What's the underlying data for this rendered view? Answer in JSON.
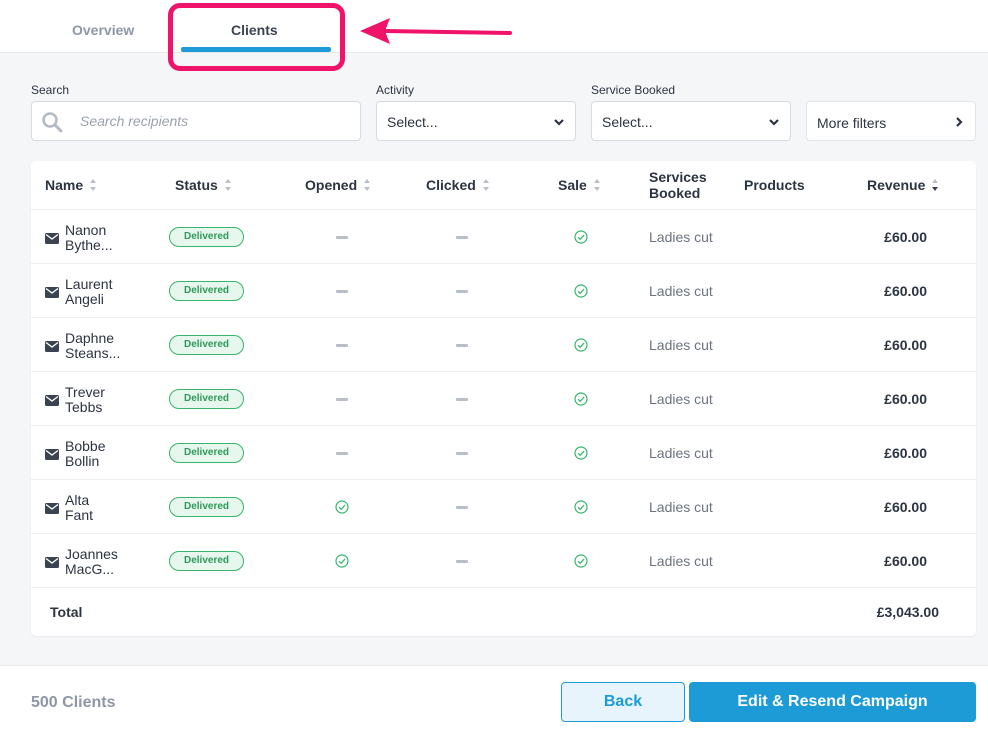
{
  "tabs": [
    {
      "label": "Overview"
    },
    {
      "label": "Clients"
    }
  ],
  "filters": {
    "search_label": "Search",
    "search_placeholder": "Search recipients",
    "activity_label": "Activity",
    "activity_value": "Select...",
    "service_label": "Service Booked",
    "service_value": "Select...",
    "more_filters": "More filters"
  },
  "table": {
    "columns": [
      "Name",
      "Status",
      "Opened",
      "Clicked",
      "Sale",
      "Services Booked",
      "Products",
      "Revenue"
    ],
    "services_booked_line1": "Services",
    "services_booked_line2": "Booked",
    "rows": [
      {
        "name1": "Nanon",
        "name2": "Bythe...",
        "status": "Delivered",
        "opened": false,
        "clicked": false,
        "sale": true,
        "service": "Ladies cut",
        "revenue": "£60.00"
      },
      {
        "name1": "Laurent",
        "name2": "Angeli",
        "status": "Delivered",
        "opened": false,
        "clicked": false,
        "sale": true,
        "service": "Ladies cut",
        "revenue": "£60.00"
      },
      {
        "name1": "Daphne",
        "name2": "Steans...",
        "status": "Delivered",
        "opened": false,
        "clicked": false,
        "sale": true,
        "service": "Ladies cut",
        "revenue": "£60.00"
      },
      {
        "name1": "Trever",
        "name2": "Tebbs",
        "status": "Delivered",
        "opened": false,
        "clicked": false,
        "sale": true,
        "service": "Ladies cut",
        "revenue": "£60.00"
      },
      {
        "name1": "Bobbe",
        "name2": "Bollin",
        "status": "Delivered",
        "opened": false,
        "clicked": false,
        "sale": true,
        "service": "Ladies cut",
        "revenue": "£60.00"
      },
      {
        "name1": "Alta",
        "name2": "Fant",
        "status": "Delivered",
        "opened": true,
        "clicked": false,
        "sale": true,
        "service": "Ladies cut",
        "revenue": "£60.00"
      },
      {
        "name1": "Joannes",
        "name2": "MacG...",
        "status": "Delivered",
        "opened": true,
        "clicked": false,
        "sale": true,
        "service": "Ladies cut",
        "revenue": "£60.00"
      }
    ],
    "total_label": "Total",
    "total_value": "£3,043.00"
  },
  "footer": {
    "client_count": "500 Clients",
    "back_label": "Back",
    "resend_label": "Edit & Resend Campaign"
  },
  "colors": {
    "accent": "#1d9bd6",
    "highlight": "#f0136a",
    "status_green": "#35b66a"
  },
  "icons": {
    "search": "search-icon",
    "mail": "mail-icon",
    "check": "check-circle-icon",
    "dash": "dash-icon",
    "chevron_down": "chevron-down-icon",
    "chevron_right": "chevron-right-icon",
    "sort": "sort-icon"
  }
}
